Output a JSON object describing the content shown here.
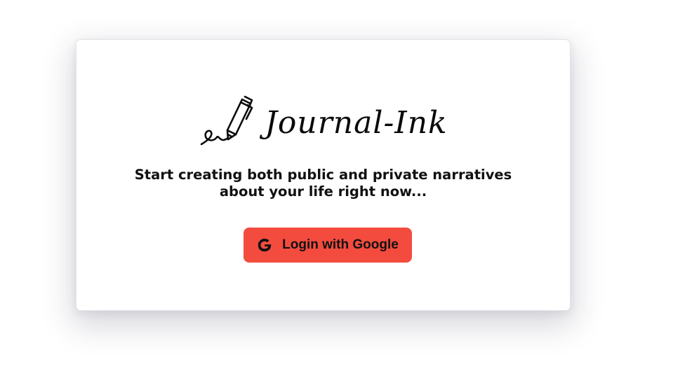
{
  "brand": {
    "title": "Journal-Ink",
    "logo_icon": "pen-signature-icon"
  },
  "tagline": {
    "line1": "Start creating both public and private narratives",
    "line2": "about your life right now..."
  },
  "login": {
    "label": "Login with Google",
    "icon": "google-g-icon",
    "background_color": "#f44b3f"
  }
}
